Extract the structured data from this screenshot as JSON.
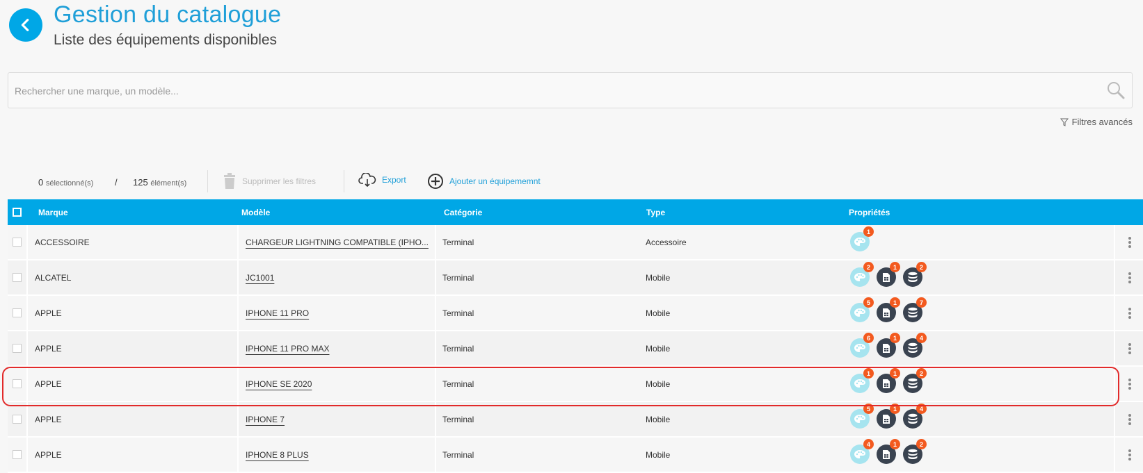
{
  "header": {
    "title": "Gestion du catalogue",
    "subtitle": "Liste des équipements disponibles"
  },
  "search": {
    "placeholder": "Rechercher une marque, un modèle...",
    "value": ""
  },
  "filters_label": "Filtres avancés",
  "toolbar": {
    "selected_count": "0",
    "selected_label": "sélectionné(s)",
    "separator": "/",
    "total_count": "125",
    "total_label": "élément(s)",
    "clear_filters": "Supprimer les filtres",
    "export": "Export",
    "add": "Ajouter un équipememnt"
  },
  "table": {
    "columns": [
      "Marque",
      "Modèle",
      "Catégorie",
      "Type",
      "Propriétés"
    ],
    "rows": [
      {
        "brand": "ACCESSOIRE",
        "model": "CHARGEUR LIGHTNING COMPATIBLE (IPHO...",
        "category": "Terminal",
        "type": "Accessoire",
        "colors": "1",
        "sims": null,
        "storage": null
      },
      {
        "brand": "ALCATEL",
        "model": "JC1001",
        "category": "Terminal",
        "type": "Mobile",
        "colors": "2",
        "sims": "1",
        "storage": "2"
      },
      {
        "brand": "APPLE",
        "model": "IPHONE 11 PRO",
        "category": "Terminal",
        "type": "Mobile",
        "colors": "5",
        "sims": "1",
        "storage": "7"
      },
      {
        "brand": "APPLE",
        "model": "IPHONE 11 PRO MAX",
        "category": "Terminal",
        "type": "Mobile",
        "colors": "6",
        "sims": "1",
        "storage": "4"
      },
      {
        "brand": "APPLE",
        "model": "IPHONE SE 2020",
        "category": "Terminal",
        "type": "Mobile",
        "colors": "1",
        "sims": "1",
        "storage": "2"
      },
      {
        "brand": "APPLE",
        "model": "IPHONE 7",
        "category": "Terminal",
        "type": "Mobile",
        "colors": "5",
        "sims": "1",
        "storage": "4"
      },
      {
        "brand": "APPLE",
        "model": "IPHONE 8 PLUS",
        "category": "Terminal",
        "type": "Mobile",
        "colors": "4",
        "sims": "1",
        "storage": "2"
      }
    ]
  },
  "colors": {
    "accent": "#00a7e6",
    "badge": "#f35a1f",
    "highlight": "#e22a2a"
  },
  "icons": [
    "back-chevron-icon",
    "search-icon",
    "filter-icon",
    "trash-icon",
    "cloud-download-icon",
    "add-circle-icon",
    "palette-icon",
    "sim-icon",
    "storage-icon",
    "kebab-menu-icon"
  ]
}
